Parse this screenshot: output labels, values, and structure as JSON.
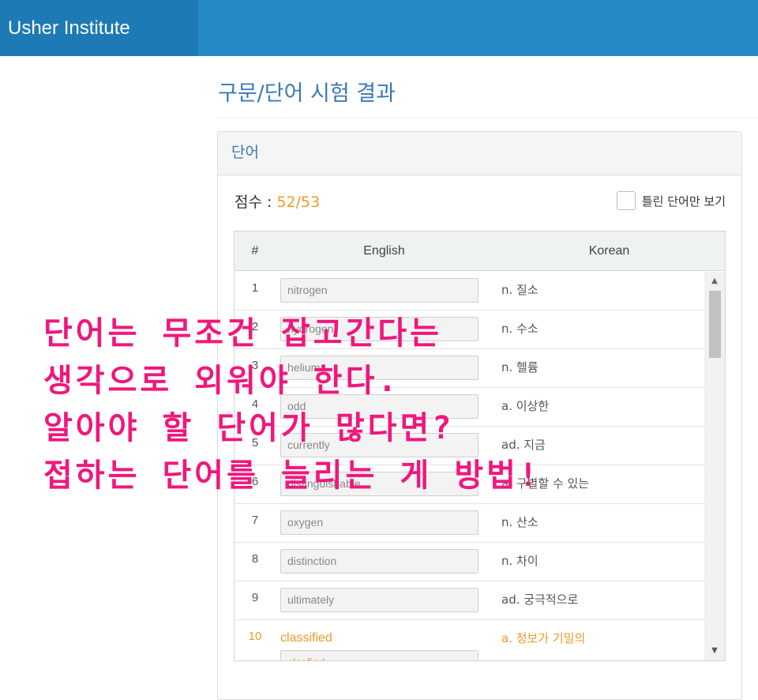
{
  "brand": {
    "name": "Usher Institute"
  },
  "page": {
    "title": "구문/단어 시험 결과"
  },
  "panel": {
    "heading": "단어",
    "score_label": "점수 : ",
    "score_value": "52/53",
    "filter_label": "틀린 단어만 보기",
    "filter_checked": false
  },
  "table": {
    "headers": {
      "num": "#",
      "english": "English",
      "korean": "Korean"
    },
    "rows": [
      {
        "num": "1",
        "english": "nitrogen",
        "korean": "n. 질소"
      },
      {
        "num": "2",
        "english": "hydrogen",
        "korean": "n. 수소"
      },
      {
        "num": "3",
        "english": "helium",
        "korean": "n. 헬륨"
      },
      {
        "num": "4",
        "english": "odd",
        "korean": "a. 이상한"
      },
      {
        "num": "5",
        "english": "currently",
        "korean": "ad. 지금"
      },
      {
        "num": "6",
        "english": "distinguishable",
        "korean": "a. 구별할 수 있는"
      },
      {
        "num": "7",
        "english": "oxygen",
        "korean": "n. 산소"
      },
      {
        "num": "8",
        "english": "distinction",
        "korean": "n. 차이"
      },
      {
        "num": "9",
        "english": "ultimately",
        "korean": "ad. 궁극적으로"
      }
    ],
    "wrong_row": {
      "num": "10",
      "correct": "classified",
      "answer": "clasfied",
      "korean": "a. 정보가 기밀의"
    }
  },
  "overlay": {
    "lines": [
      "단어는 무조건 잡고간다는",
      "생각으로 외워야 한다.",
      "알아야 할 단어가 많다면?",
      "접하는 단어를 늘리는 게 방법!"
    ]
  },
  "colors": {
    "topbar": "#268ac6",
    "brand_bg": "#1e7ab5",
    "title": "#3d78b6",
    "score": "#ec9a2a",
    "overlay": "#f0177c"
  }
}
